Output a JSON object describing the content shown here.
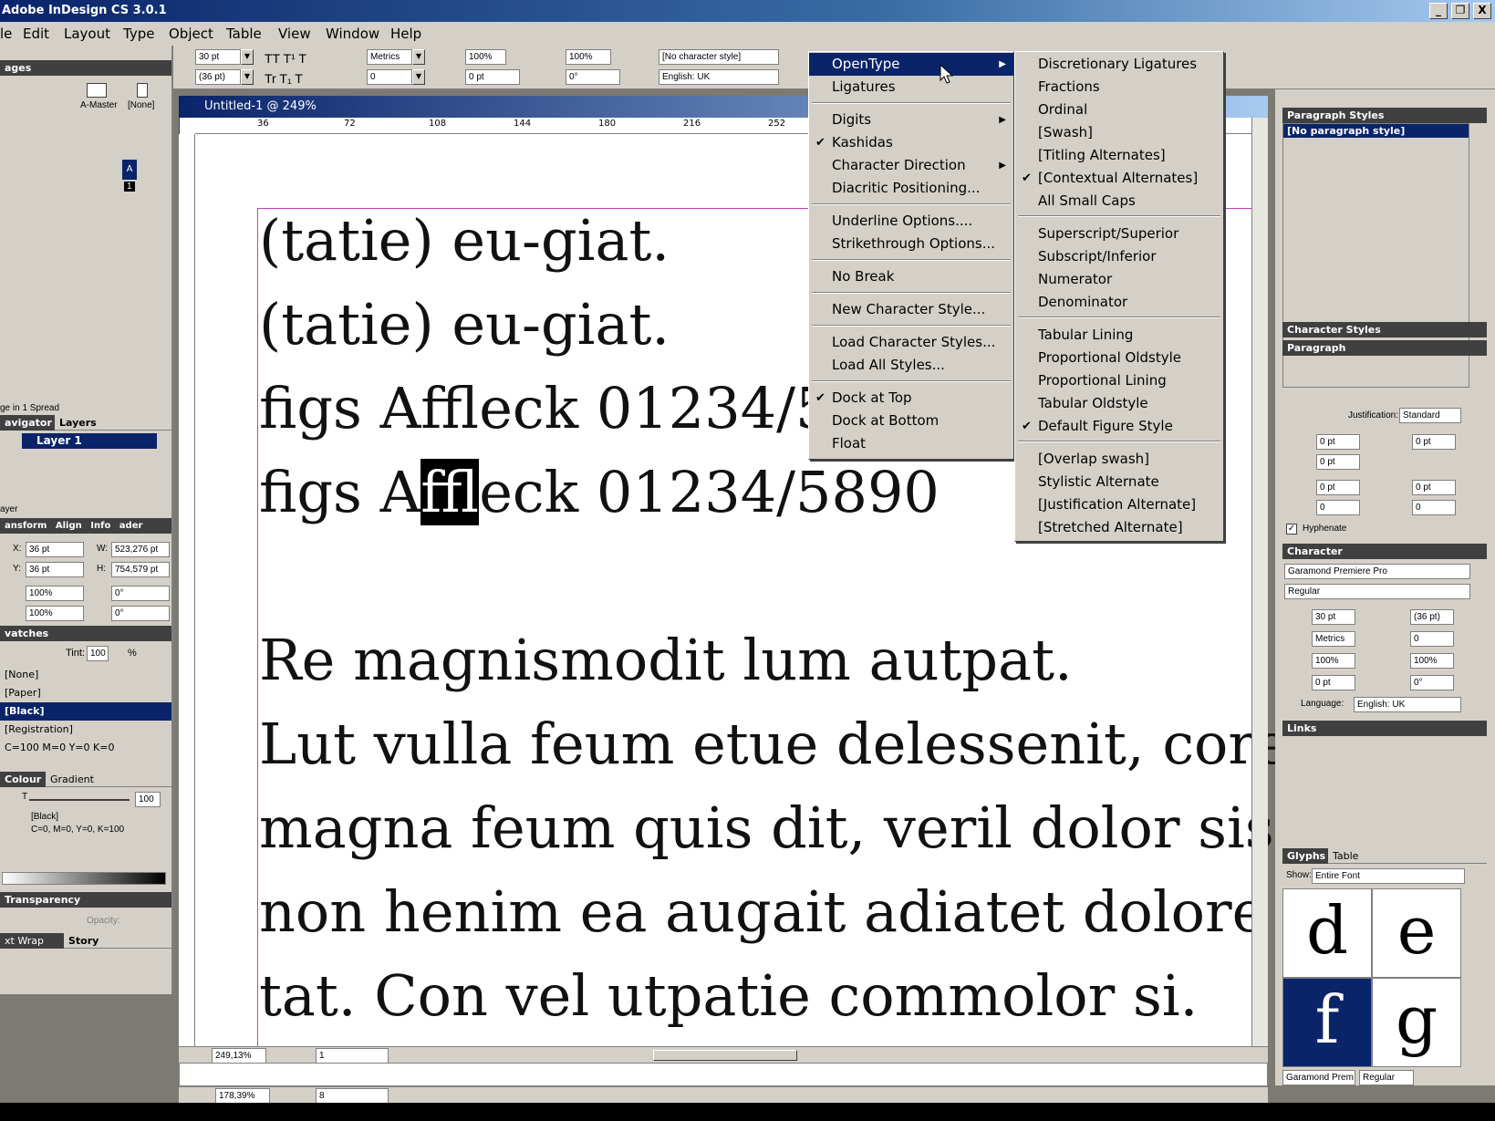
{
  "window": {
    "title": "Adobe InDesign CS 3.0.1",
    "min": "_",
    "restore": "❐",
    "close": "X"
  },
  "menubar": [
    "le",
    "Edit",
    "Layout",
    "Type",
    "Object",
    "Table",
    "View",
    "Window",
    "Help"
  ],
  "control": {
    "font_size": "30 pt",
    "leading": "(36 pt)",
    "kerning": "Metrics",
    "tracking": "0",
    "vscale": "100%",
    "hscale": "100%",
    "baseline": "0 pt",
    "skew": "0°",
    "char_style": "[No character style]",
    "language": "English: UK"
  },
  "document": {
    "title": "Untitled-1 @ 249%",
    "ruler": [
      "36",
      "72",
      "108",
      "144",
      "180",
      "216",
      "252"
    ],
    "lines": [
      "(tatie) eu-giat.",
      "(tatie) eu-giat.",
      "figs Affleck 01234/5",
      "figs A",
      "ffl",
      "eck 01234/5890",
      "Re magnismodit lum autpat.",
      "Lut vulla feum etue delessenit, core",
      "magna feum quis dit, veril dolor sis",
      "non henim ea augait adiatet dolore",
      "tat. Con vel utpatie commolor si."
    ],
    "zoom": "249,13%",
    "page": "1",
    "zoom2": "178,39%",
    "page2": "8"
  },
  "left": {
    "pages_tab": "ages",
    "master": "A-Master",
    "none": "[None]",
    "spread_label": "A",
    "page_num": "1",
    "spread_info": "ge in 1 Spread",
    "tabs1": [
      "avigator",
      "Layers"
    ],
    "layer": "Layer 1",
    "layer_footer": "ayer",
    "tabs2": [
      "ansform",
      "Align",
      "Info",
      "ader"
    ],
    "x": "36 pt",
    "y": "36 pt",
    "w": "523,276 pt",
    "h": "754,579 pt",
    "sx": "100%",
    "sy": "100%",
    "rot": "0°",
    "shear": "0°",
    "x_label": "X:",
    "y_label": "Y:",
    "w_label": "W:",
    "h_label": "H:",
    "swatches_tab": "vatches",
    "tint_label": "Tint:",
    "tint": "100",
    "pct": "%",
    "swatches": [
      "[None]",
      "[Paper]",
      "[Black]",
      "[Registration]",
      "C=100 M=0 Y=0 K=0"
    ],
    "colour_tabs": [
      "Colour",
      "Gradient"
    ],
    "colour_t": "T",
    "colour_value": "100",
    "colour_name": "[Black]",
    "colour_cmyk": "C=0, M=0, Y=0, K=100",
    "transparency": "Transparency",
    "opacity_label": "Opacity:",
    "bottom_tabs": [
      "xt Wrap",
      "Story"
    ]
  },
  "opentype_menu": {
    "items": [
      "OpenType",
      "Ligatures",
      "Digits",
      "Kashidas",
      "Character Direction",
      "Diacritic Positioning...",
      "Underline Options....",
      "Strikethrough Options...",
      "No Break",
      "New Character Style...",
      "Load Character Styles...",
      "Load All Styles...",
      "Dock at Top",
      "Dock at Bottom",
      "Float"
    ]
  },
  "submenu": {
    "items": [
      "Discretionary Ligatures",
      "Fractions",
      "Ordinal",
      "[Swash]",
      "[Titling Alternates]",
      "[Contextual Alternates]",
      "All Small Caps",
      "Superscript/Superior",
      "Subscript/Inferior",
      "Numerator",
      "Denominator",
      "Tabular Lining",
      "Proportional Oldstyle",
      "Proportional Lining",
      "Tabular Oldstyle",
      "Default Figure Style",
      "[Overlap swash]",
      "Stylistic Alternate",
      "[Justification Alternate]",
      "[Stretched Alternate]"
    ]
  },
  "right": {
    "para_styles": "Paragraph Styles",
    "no_para_style": "[No paragraph style]",
    "char_styles": "Character Styles",
    "paragraph": "Paragraph",
    "justification_label": "Justification:",
    "justification": "Standard",
    "indent": "0 pt",
    "zero": "0",
    "hyphenate": "Hyphenate",
    "character": "Character",
    "font": "Garamond Premiere Pro",
    "style": "Regular",
    "size": "30 pt",
    "leading": "(36 pt)",
    "kern": "Metrics",
    "track": "0",
    "vscale": "100%",
    "hscale": "100%",
    "base": "0 pt",
    "skew": "0°",
    "language_label": "Language:",
    "language": "English: UK",
    "links": "Links",
    "glyph_tabs": [
      "Glyphs",
      "Table"
    ],
    "show_label": "Show:",
    "show": "Entire Font",
    "glyphs": [
      "d",
      "e",
      "f",
      "g"
    ],
    "glyph_font": "Garamond Prem",
    "glyph_style": "Regular"
  }
}
